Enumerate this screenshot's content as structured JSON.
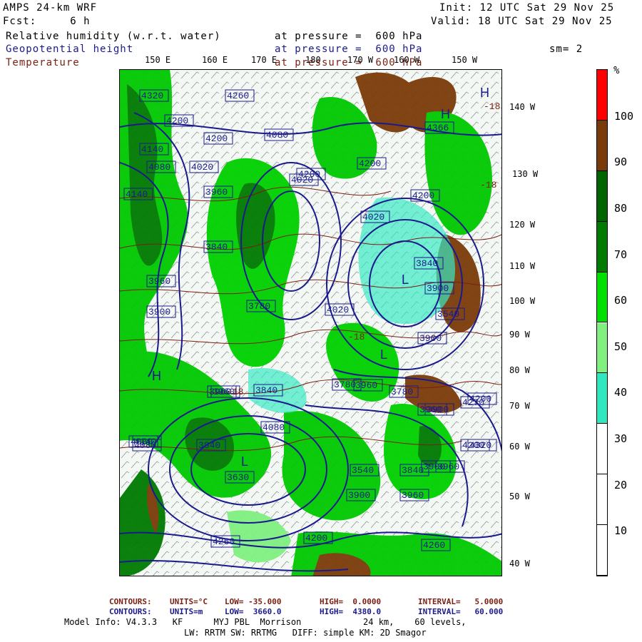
{
  "header": {
    "model": "AMPS 24-km WRF",
    "init": "Init: 12 UTC Sat 29 Nov 25",
    "fcst": "Fcst:     6 h",
    "valid": "Valid: 18 UTC Sat 29 Nov 25",
    "fields": [
      {
        "name": "Relative humidity (w.r.t. water)",
        "pressure": "at pressure =  600 hPa",
        "color": "#000000"
      },
      {
        "name": "Geopotential height",
        "pressure": "at pressure =  600 hPa",
        "color": "#1a1a8c"
      },
      {
        "name": "Temperature",
        "pressure": "at pressure =  600 hPa",
        "color": "#7a1f12"
      }
    ],
    "smoothing": "sm= 2"
  },
  "lon_labels_top": [
    "150 E",
    "160 E",
    "170 E",
    "180",
    "170 W",
    "160 W",
    "150 W"
  ],
  "lat_labels_right": [
    "140 W",
    "130 W",
    "120 W",
    "110 W",
    "100 W",
    "90 W",
    "80 W",
    "70 W",
    "60 W",
    "50 W",
    "40 W"
  ],
  "height_labels": [
    "4320",
    "4200",
    "4260",
    "4200",
    "4080",
    "4140",
    "4080",
    "4020",
    "4200",
    "4366",
    "3960",
    "4020",
    "4020",
    "4200",
    "4140",
    "3840",
    "3960",
    "3780",
    "3840",
    "3900",
    "3540",
    "3900",
    "3900",
    "4020",
    "3960",
    "3840",
    "3960",
    "3780",
    "3840",
    "3780",
    "4140",
    "4200",
    "4080",
    "3960",
    "3900",
    "3630",
    "3960",
    "3840",
    "3900",
    "4260",
    "4200",
    "4260",
    "4320",
    "4200",
    "3960",
    "4080",
    "4270",
    "4200",
    "3900",
    "4080",
    "3960",
    "3540"
  ],
  "temp_labels": [
    "-18",
    "-18",
    "-18",
    "-18"
  ],
  "pressure_centers": [
    "H",
    "H",
    "H",
    "L",
    "L",
    "L"
  ],
  "colorbar": {
    "unit": "%",
    "ticks": [
      "100",
      "90",
      "80",
      "70",
      "60",
      "50",
      "40",
      "30",
      "20",
      "10"
    ],
    "colors": [
      "#ff0000",
      "#7a3b0a",
      "#006400",
      "#007a00",
      "#00e000",
      "#80f080",
      "#30e8c0",
      "#ffffff",
      "#ffffff",
      "#ffffff"
    ]
  },
  "footer": {
    "temp_contours": {
      "label": "CONTOURS:",
      "units": "UNITS=°C",
      "low": "LOW= -35.000",
      "high": "HIGH=  0.0000",
      "interval": "INTERVAL=   5.0000"
    },
    "height_contours": {
      "label": "CONTOURS:",
      "units": "UNITS=m",
      "low": "LOW=  3660.0",
      "high": "HIGH=  4380.0",
      "interval": "INTERVAL=   60.000"
    },
    "model_info": "Model Info: V4.3.3   KF      MYJ PBL  Morrison            24 km,    60 levels,",
    "model_info2": "LW: RRTM SW: RRTMG   DIFF: simple KM: 2D Smagor"
  }
}
